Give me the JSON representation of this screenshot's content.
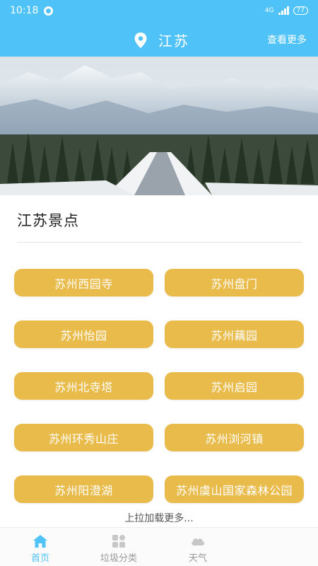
{
  "status_bar": {
    "time": "10:18",
    "network": "4G",
    "battery": "77"
  },
  "header": {
    "city": "江苏",
    "more_label": "查看更多"
  },
  "section": {
    "title": "江苏景点"
  },
  "spots": [
    "苏州西园寺",
    "苏州盘门",
    "苏州怡园",
    "苏州藕园",
    "苏州北寺塔",
    "苏州启园",
    "苏州环秀山庄",
    "苏州浏河镇",
    "苏州阳澄湖",
    "苏州虞山国家森林公园"
  ],
  "load_more": "上拉加载更多...",
  "tabs": [
    {
      "label": "首页",
      "icon": "home-icon",
      "active": true
    },
    {
      "label": "垃圾分类",
      "icon": "grid-icon",
      "active": false
    },
    {
      "label": "天气",
      "icon": "cloud-icon",
      "active": false
    }
  ],
  "colors": {
    "primary": "#4fc3f7",
    "button": "#e9bb4a"
  }
}
